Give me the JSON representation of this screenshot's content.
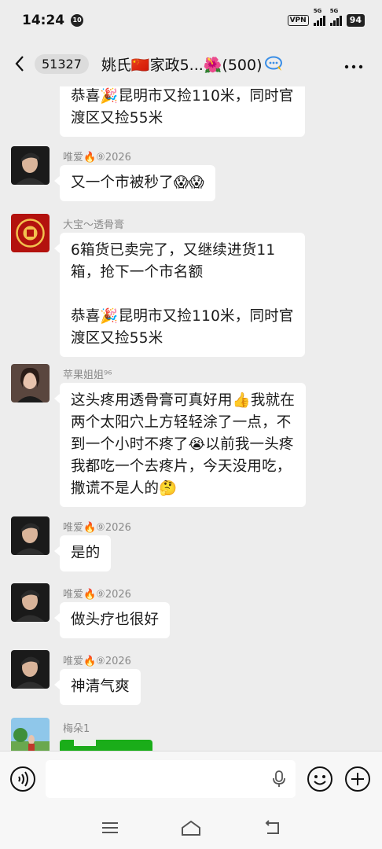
{
  "status_bar": {
    "time": "14:24",
    "notification_badge": "10",
    "vpn": "VPN",
    "network_1": "5G",
    "network_2": "5G",
    "battery": "94"
  },
  "header": {
    "unread_count": "51327",
    "title": "姚氏🇨🇳家政5...🌺(500)"
  },
  "messages": [
    {
      "id": "m0",
      "sender": "",
      "avatar": "none",
      "text": "恭喜🎉昆明市又捡110米，同时官\n渡区又捡55米"
    },
    {
      "id": "m1",
      "sender": "唯爱🔥⑨2026",
      "avatar": "man-portrait",
      "text": "又一个市被秒了😱😱"
    },
    {
      "id": "m2",
      "sender": "大宝～透骨膏",
      "avatar": "red-logo",
      "text": "6箱货已卖完了，又继续进货11\n箱，抢下一个市名额\n\n恭喜🎉昆明市又捡110米，同时官\n渡区又捡55米"
    },
    {
      "id": "m3",
      "sender": "苹果姐姐⁹⁶",
      "avatar": "woman-portrait",
      "text": "这头疼用透骨膏可真好用👍我就在\n两个太阳穴上方轻轻涂了一点，不\n到一个小时不疼了😭以前我一头疼\n我都吃一个去疼片，今天没用吃，\n撒谎不是人的🤔"
    },
    {
      "id": "m4",
      "sender": "唯爱🔥⑨2026",
      "avatar": "man-portrait",
      "text": "是的"
    },
    {
      "id": "m5",
      "sender": "唯爱🔥⑨2026",
      "avatar": "man-portrait",
      "text": "做头疗也很好"
    },
    {
      "id": "m6",
      "sender": "唯爱🔥⑨2026",
      "avatar": "man-portrait",
      "text": "神清气爽"
    },
    {
      "id": "m7",
      "sender": "梅朵1",
      "avatar": "landscape",
      "text": ""
    }
  ],
  "colors": {
    "background": "#ededed",
    "bubble": "#ffffff",
    "sender_text": "#8a8a8a",
    "green_preview": "#1aad19"
  }
}
